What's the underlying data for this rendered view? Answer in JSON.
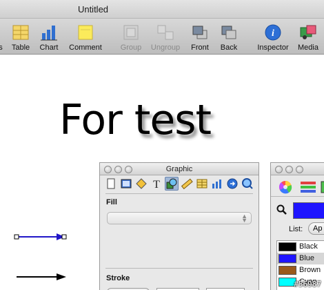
{
  "window": {
    "title": "Untitled"
  },
  "toolbar": {
    "items": [
      {
        "label": "s",
        "icon": "partial-icon",
        "disabled": false
      },
      {
        "label": "Table",
        "icon": "table-icon",
        "disabled": false
      },
      {
        "label": "Chart",
        "icon": "chart-icon",
        "disabled": false
      },
      {
        "label": "Comment",
        "icon": "comment-icon",
        "disabled": false
      },
      {
        "label": "Group",
        "icon": "group-icon",
        "disabled": true
      },
      {
        "label": "Ungroup",
        "icon": "ungroup-icon",
        "disabled": true
      },
      {
        "label": "Front",
        "icon": "bring-front-icon",
        "disabled": false
      },
      {
        "label": "Back",
        "icon": "send-back-icon",
        "disabled": false
      },
      {
        "label": "Inspector",
        "icon": "info-icon",
        "disabled": false
      },
      {
        "label": "Media",
        "icon": "media-icon",
        "disabled": false
      }
    ]
  },
  "canvas": {
    "text_plain": "For ",
    "text_shadowed": "test"
  },
  "inspector": {
    "title": "Graphic",
    "fill_label": "Fill",
    "stroke_label": "Stroke"
  },
  "colors_panel": {
    "list_label": "List:",
    "list_button": "Ap",
    "selected_color": "#1e14ff",
    "colors": [
      {
        "name": "Black",
        "hex": "#000000"
      },
      {
        "name": "Blue",
        "hex": "#1e14ff"
      },
      {
        "name": "Brown",
        "hex": "#9a5a1c"
      },
      {
        "name": "Cyan",
        "hex": "#00ffff"
      }
    ]
  },
  "watermark": "#56987"
}
